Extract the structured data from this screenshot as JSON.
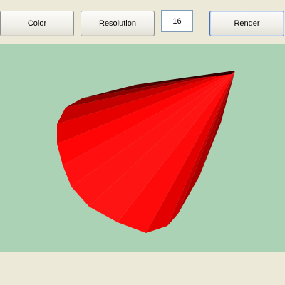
{
  "toolbar": {
    "color_label": "Color",
    "resolution_label": "Resolution",
    "resolution_value": "16",
    "render_label": "Render"
  },
  "viewport": {
    "background_color": "#abd2b5",
    "shape": "cone",
    "shape_color": "#ff0000"
  }
}
